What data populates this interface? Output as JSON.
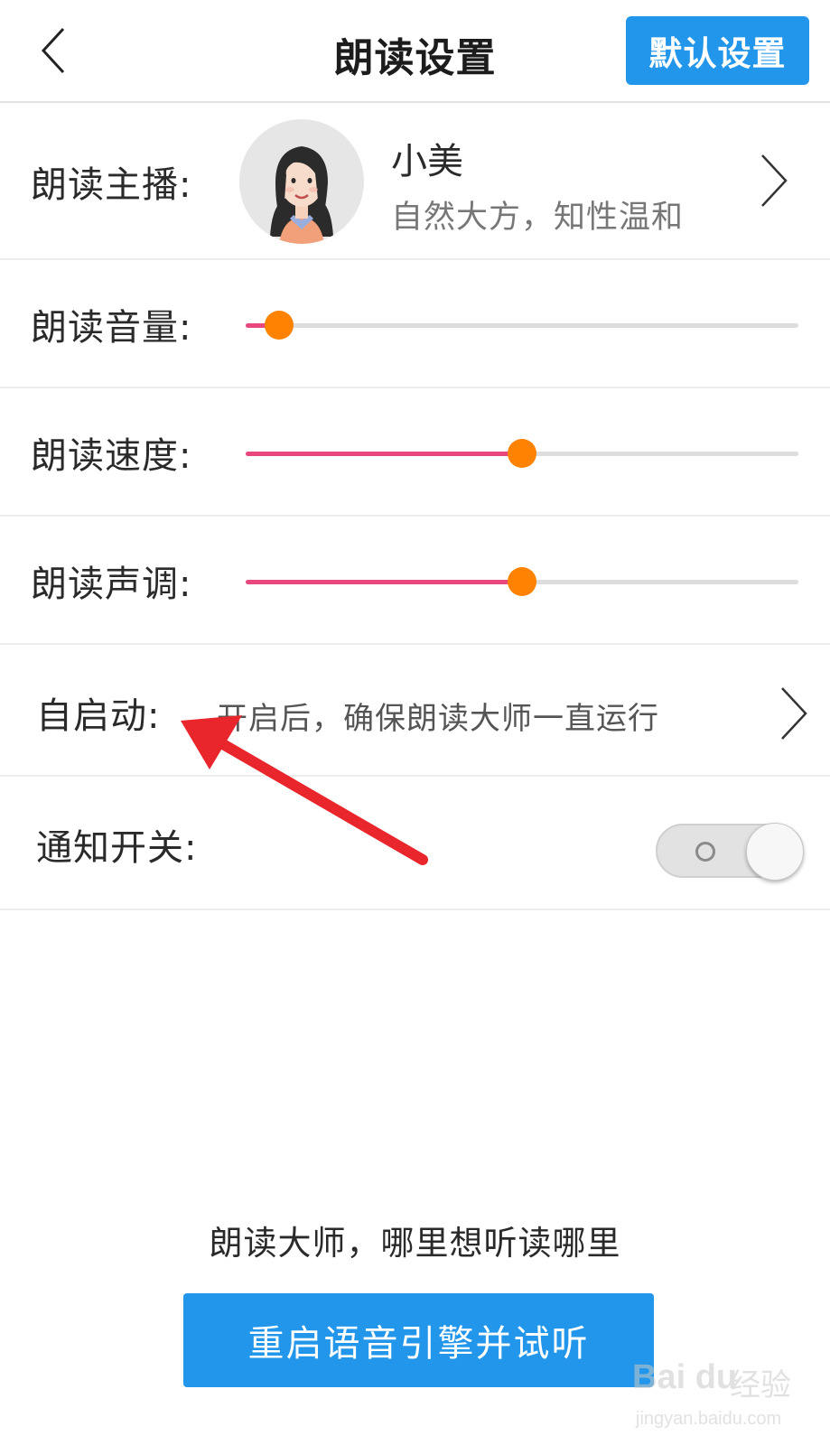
{
  "header": {
    "title": "朗读设置",
    "default_button": "默认设置"
  },
  "anchor": {
    "label": "朗读主播:",
    "name": "小美",
    "description": "自然大方，知性温和"
  },
  "sliders": [
    {
      "label": "朗读音量:",
      "level_percent": 6
    },
    {
      "label": "朗读速度:",
      "level_percent": 50
    },
    {
      "label": "朗读声调:",
      "level_percent": 50
    }
  ],
  "autostart": {
    "label": "自启动:",
    "description": "开启后，确保朗读大师一直运行"
  },
  "notification": {
    "label": "通知开关:",
    "enabled": true
  },
  "footer": {
    "slogan": "朗读大师，哪里想听读哪里",
    "restart_button": "重启语音引擎并试听"
  },
  "watermark": {
    "logo": "Bai du",
    "text": "经验",
    "url": "jingyan.baidu.com"
  },
  "colors": {
    "accent_blue": "#2196ea",
    "slider_fill": "#e8487e",
    "slider_thumb": "#ff8200"
  },
  "icons": [
    "back-chevron-icon",
    "chevron-right-icon",
    "toggle-switch",
    "annotation-arrow"
  ]
}
